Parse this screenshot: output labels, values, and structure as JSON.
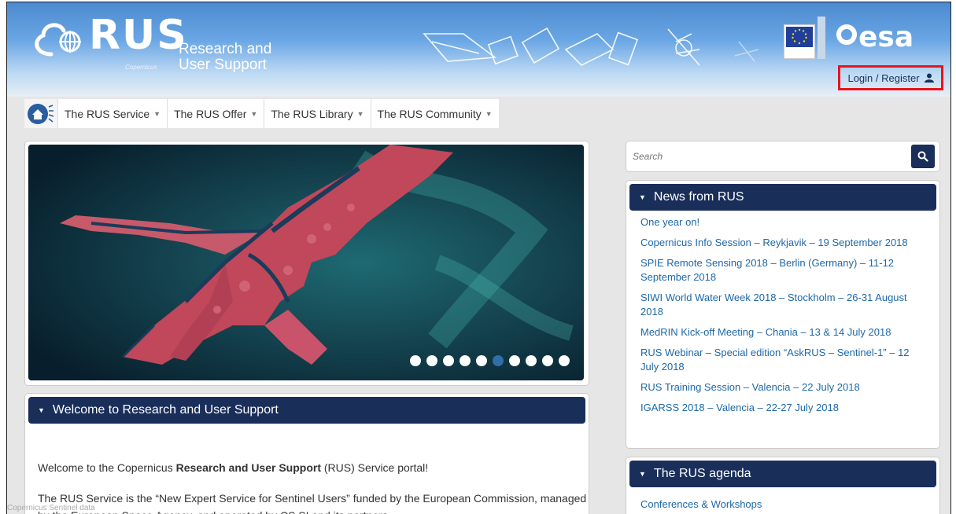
{
  "header": {
    "logo_text": "RUS",
    "logo_sub": "Copernicus",
    "tagline_line1": "Research and",
    "tagline_line2": "User Support",
    "esa_text": "esa",
    "login_label": "Login / Register"
  },
  "nav": {
    "items": [
      {
        "label": "The RUS Service"
      },
      {
        "label": "The RUS Offer"
      },
      {
        "label": "The RUS Library"
      },
      {
        "label": "The RUS Community"
      }
    ]
  },
  "carousel": {
    "dot_count": 10,
    "active_dot": 6
  },
  "welcome": {
    "title": "Welcome to Research and User Support",
    "p1_before": "Welcome to the Copernicus ",
    "p1_bold": "Research and User Support",
    "p1_after": " (RUS) Service portal!",
    "p2": "The RUS Service is the “New Expert Service for Sentinel Users” funded by the European Commission, managed by the European Space Agency, and operated by CS SI and its partners."
  },
  "credit": "Copernicus Sentinel data",
  "search": {
    "placeholder": "Search"
  },
  "news": {
    "title": "News from RUS",
    "items": [
      "One year on!",
      "Copernicus Info Session – Reykjavik – 19 September 2018",
      "SPIE Remote Sensing 2018 – Berlin (Germany) – 11-12 September 2018",
      "SIWI World Water Week 2018 – Stockholm – 26-31 August 2018",
      "MedRIN Kick-off Meeting – Chania – 13 & 14 July 2018",
      "RUS Webinar – Special edition “AskRUS – Sentinel-1” – 12 July 2018",
      "RUS Training Session – Valencia – 22 July 2018",
      "IGARSS 2018 – Valencia – 22-27 July 2018"
    ]
  },
  "agenda": {
    "title": "The RUS agenda",
    "link": "Conferences & Workshops"
  }
}
